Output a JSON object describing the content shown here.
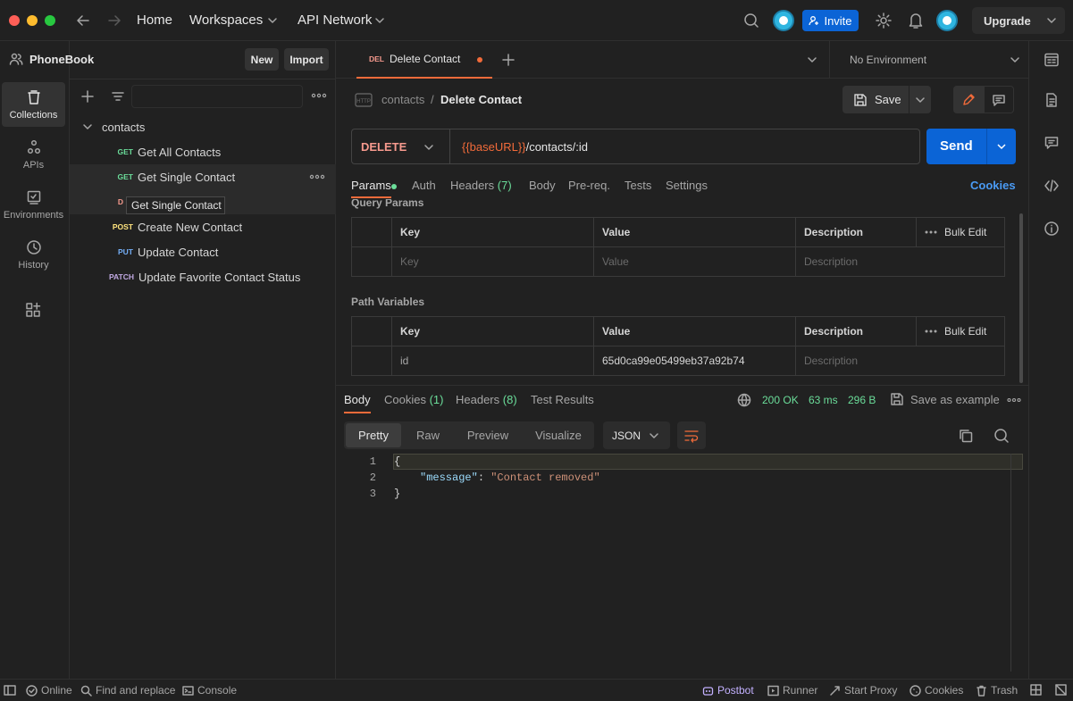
{
  "topbar": {
    "home": "Home",
    "workspaces": "Workspaces",
    "api_network": "API Network",
    "invite": "Invite",
    "upgrade": "Upgrade"
  },
  "rail": {
    "collections": "Collections",
    "apis": "APIs",
    "environments": "Environments",
    "history": "History"
  },
  "sidebar": {
    "workspace": "PhoneBook",
    "new_btn": "New",
    "import_btn": "Import",
    "folder": "contacts",
    "items": [
      {
        "method": "GET",
        "name": "Get All Contacts"
      },
      {
        "method": "GET",
        "name": "Get Single Contact"
      },
      {
        "method": "D",
        "name": ""
      },
      {
        "method": "POST",
        "name": "Create New Contact"
      },
      {
        "method": "PUT",
        "name": "Update Contact"
      },
      {
        "method": "PATCH",
        "name": "Update Favorite Contact Status"
      }
    ],
    "tooltip": "Get Single Contact"
  },
  "tabs": {
    "active_method": "DEL",
    "active_name": "Delete Contact",
    "environment": "No Environment"
  },
  "request": {
    "breadcrumb_parent": "contacts",
    "breadcrumb_sep": "/",
    "breadcrumb_name": "Delete Contact",
    "save": "Save",
    "method": "DELETE",
    "url_var": "{{baseURL}}",
    "url_path": "/contacts/:id",
    "send": "Send",
    "subtabs": {
      "params": "Params",
      "auth": "Auth",
      "headers": "Headers",
      "headers_count": "(7)",
      "body": "Body",
      "prereq": "Pre-req.",
      "tests": "Tests",
      "settings": "Settings",
      "cookies": "Cookies"
    },
    "query_params_title": "Query Params",
    "path_vars_title": "Path Variables",
    "table_headers": {
      "key": "Key",
      "value": "Value",
      "description": "Description",
      "bulk_edit": "Bulk Edit"
    },
    "query_placeholder": {
      "key": "Key",
      "value": "Value",
      "description": "Description"
    },
    "path_row": {
      "key": "id",
      "value": "65d0ca99e05499eb37a92b74",
      "description": "Description"
    }
  },
  "response": {
    "tabs": {
      "body": "Body",
      "cookies": "Cookies",
      "cookies_count": "(1)",
      "headers": "Headers",
      "headers_count": "(8)",
      "test_results": "Test Results"
    },
    "status": "200 OK",
    "time": "63 ms",
    "size": "296 B",
    "save_example": "Save as example",
    "views": {
      "pretty": "Pretty",
      "raw": "Raw",
      "preview": "Preview",
      "visualize": "Visualize"
    },
    "format": "JSON",
    "lines": [
      {
        "n": "1",
        "open": "{"
      },
      {
        "n": "2",
        "key": "\"message\"",
        "colon": ":",
        "value": "\"Contact removed\""
      },
      {
        "n": "3",
        "close": "}"
      }
    ]
  },
  "statusbar": {
    "online": "Online",
    "find": "Find and replace",
    "console": "Console",
    "postbot": "Postbot",
    "runner": "Runner",
    "proxy": "Start Proxy",
    "cookies": "Cookies",
    "trash": "Trash"
  },
  "colors": {
    "accent": "#0b64d6",
    "brand": "#f26b3a",
    "get": "#6bdd9a",
    "delete": "#f79a8e",
    "post": "#ffe47e",
    "put": "#74aef6",
    "patch": "#c0a8e1"
  }
}
